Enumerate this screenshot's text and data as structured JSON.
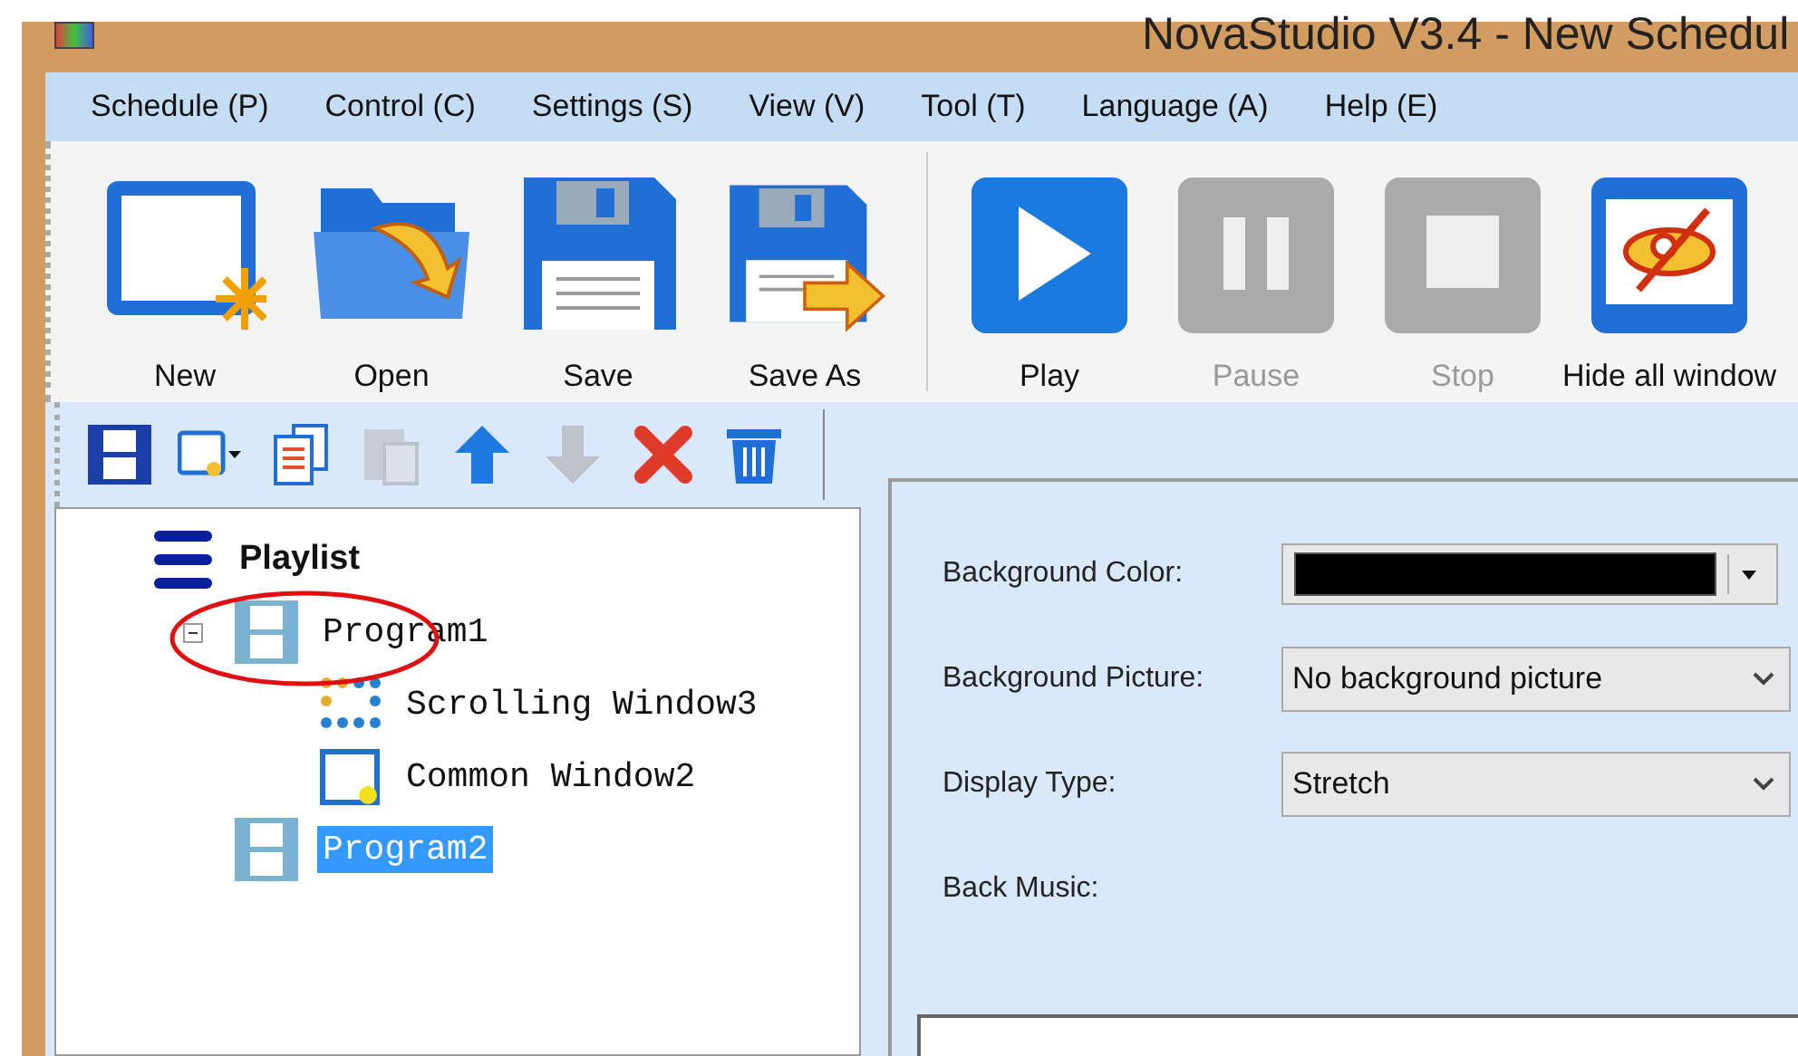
{
  "window": {
    "title": "NovaStudio V3.4 - New Schedul"
  },
  "menu": [
    "Schedule (P)",
    "Control (C)",
    "Settings (S)",
    "View (V)",
    "Tool (T)",
    "Language (A)",
    "Help (E)"
  ],
  "toolbar": [
    {
      "kind": "button",
      "label": "New",
      "disabled": false
    },
    {
      "kind": "button",
      "label": "Open",
      "disabled": false
    },
    {
      "kind": "button",
      "label": "Save",
      "disabled": false
    },
    {
      "kind": "button",
      "label": "Save As",
      "disabled": false
    },
    {
      "kind": "separator"
    },
    {
      "kind": "button",
      "label": "Play",
      "disabled": false
    },
    {
      "kind": "button",
      "label": "Pause",
      "disabled": true
    },
    {
      "kind": "button",
      "label": "Stop",
      "disabled": true
    },
    {
      "kind": "button",
      "label": "Hide all window",
      "disabled": false
    }
  ],
  "tree_toolbar": [
    {
      "disabled": false
    },
    {
      "disabled": false
    },
    {
      "disabled": false
    },
    {
      "disabled": true
    },
    {
      "disabled": false
    },
    {
      "disabled": true
    },
    {
      "disabled": false
    },
    {
      "disabled": false
    }
  ],
  "tree": {
    "label": "Playlist",
    "kind": "playlist",
    "selected": false,
    "children": [
      {
        "label": "Program1",
        "kind": "program",
        "selected": false,
        "expanded": true,
        "circled": true,
        "children": [
          {
            "label": "Scrolling Window3",
            "kind": "scroll",
            "selected": false
          },
          {
            "label": "Common Window2",
            "kind": "common",
            "selected": false
          }
        ]
      },
      {
        "label": "Program2",
        "kind": "program",
        "selected": true
      }
    ]
  },
  "form": [
    {
      "kind": "color",
      "label": "Background Color:",
      "color": "#000000"
    },
    {
      "kind": "select",
      "label": "Background Picture:",
      "value": "No background picture"
    },
    {
      "kind": "select",
      "label": "Display Type:",
      "value": "Stretch"
    },
    {
      "kind": "label",
      "label": "Back Music:"
    }
  ]
}
